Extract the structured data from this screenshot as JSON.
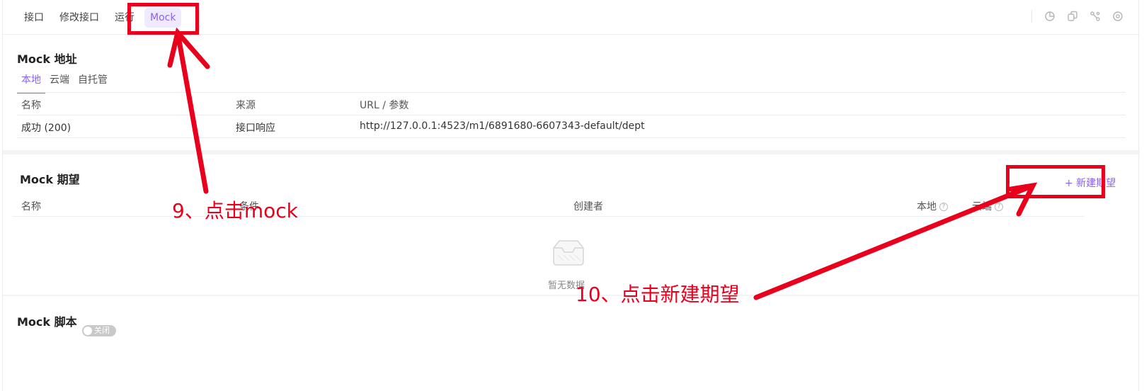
{
  "tabs": [
    {
      "label": "接口"
    },
    {
      "label": "修改接口"
    },
    {
      "label": "运行"
    },
    {
      "label": "Mock"
    }
  ],
  "mock_address": {
    "title": "Mock 地址",
    "subtabs": [
      "本地",
      "云端",
      "自托管"
    ],
    "columns": [
      "名称",
      "来源",
      "URL / 参数"
    ],
    "rows": [
      {
        "name": "成功 (200)",
        "source": "接口响应",
        "url": "http://127.0.0.1:4523/m1/6891680-6607343-default/dept"
      }
    ]
  },
  "mock_expectation": {
    "title": "Mock 期望",
    "new_button": "+ 新建期望",
    "columns": [
      "名称",
      "条件",
      "创建者",
      "本地",
      "云端"
    ],
    "empty_text": "暂无数据"
  },
  "mock_script": {
    "title": "Mock 脚本",
    "toggle_label": "关闭"
  },
  "annotations": {
    "step9": "9、点击mock",
    "step10": "10、点击新建期望"
  },
  "colors": {
    "accent": "#8a63f0",
    "annotation": "#e8001c"
  }
}
